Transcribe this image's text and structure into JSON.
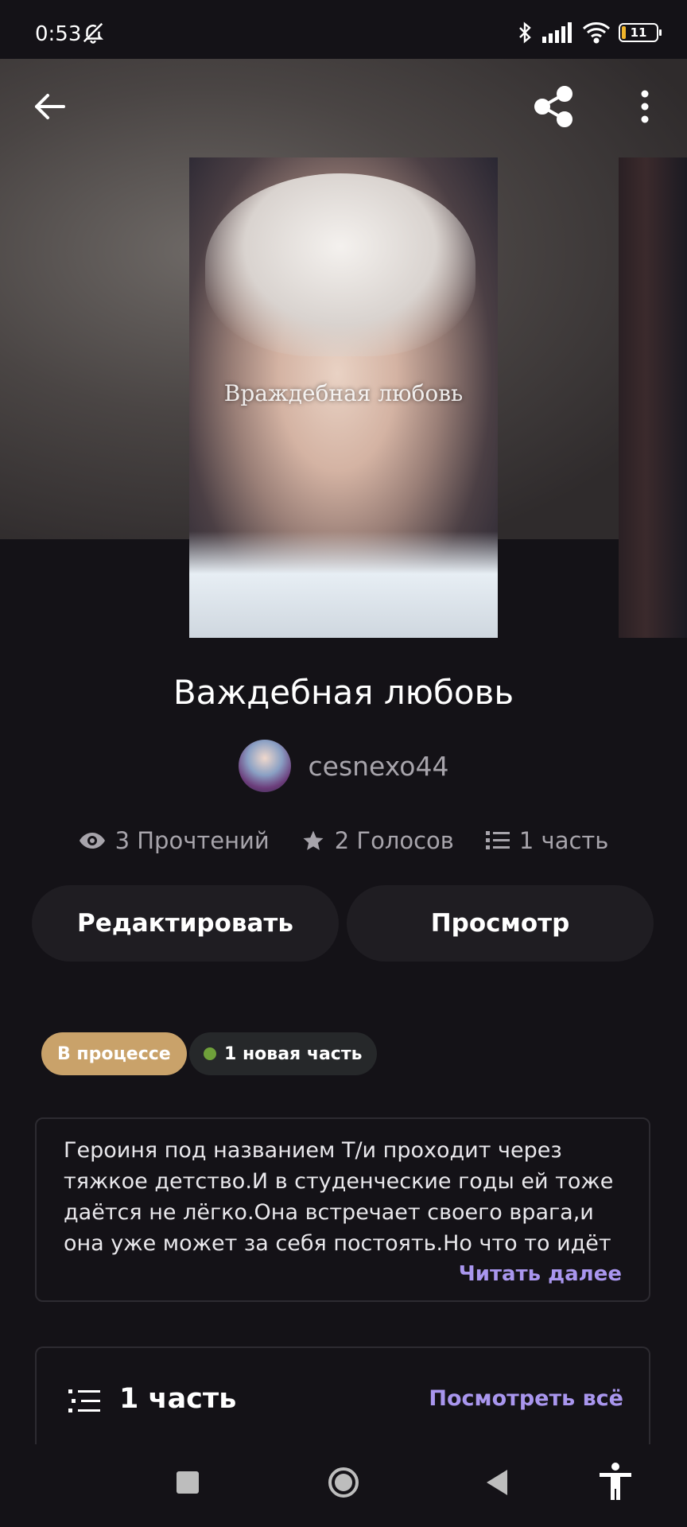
{
  "status_bar": {
    "time": "0:53",
    "battery": "11",
    "battery_level_percent": 11,
    "icons": [
      "bell-off-icon",
      "bluetooth-icon",
      "signal-icon",
      "wifi-icon",
      "battery-icon"
    ]
  },
  "header": {
    "back_icon": "arrow-left-icon",
    "share_icon": "share-icon",
    "more_icon": "more-vertical-icon"
  },
  "cover": {
    "title_text": "Враждебная любовь"
  },
  "story": {
    "title": "Важдебная любовь",
    "author": "cesnexo44",
    "stats": {
      "reads": "3 Прочтений",
      "votes": "2 Голосов",
      "parts": "1 часть"
    }
  },
  "actions": {
    "edit_label": "Редактировать",
    "preview_label": "Просмотр"
  },
  "badges": {
    "status": "В процессе",
    "new_parts": "1 новая часть"
  },
  "description": {
    "text": "Героиня под названием Т/и проходит через тяжкое детство.И в студенческие годы ей тоже даётся не лёгко.Она встречает своего врага,и она уже может за  себя постоять.Но что то идёт не так",
    "read_more": "Читать далее"
  },
  "parts_section": {
    "title": "1 часть",
    "see_all": "Посмотреть всё"
  },
  "colors": {
    "background": "#141217",
    "accent": "#a996ee",
    "status_badge": "#c9a26a",
    "new_dot": "#6fa03a"
  }
}
